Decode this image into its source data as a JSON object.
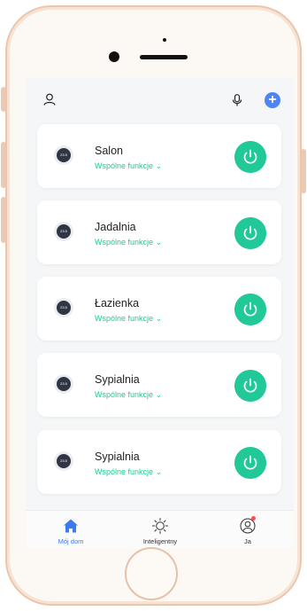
{
  "colors": {
    "accent": "#20c997",
    "primary_blue": "#4f84f5",
    "active_tab": "#3a7bf0",
    "badge": "#ff4d4f"
  },
  "header": {
    "left_icon": "user-icon",
    "right_icons": [
      "microphone-icon",
      "plus-icon"
    ]
  },
  "rooms": [
    {
      "name": "Salon",
      "subtitle": "Wspólne funkcje",
      "thermostat_reading": "23.5"
    },
    {
      "name": "Jadalnia",
      "subtitle": "Wspólne funkcje",
      "thermostat_reading": "23.5"
    },
    {
      "name": "Łazienka",
      "subtitle": "Wspólne funkcje",
      "thermostat_reading": "23.5"
    },
    {
      "name": "Sypialnia",
      "subtitle": "Wspólne funkcje",
      "thermostat_reading": "23.5"
    },
    {
      "name": "Sypialnia",
      "subtitle": "Wspólne funkcje",
      "thermostat_reading": "23.5"
    }
  ],
  "tabs": [
    {
      "label": "Mój dom",
      "icon": "home-icon",
      "active": true
    },
    {
      "label": "Inteligentny",
      "icon": "sun-icon",
      "active": false
    },
    {
      "label": "Ja",
      "icon": "profile-icon",
      "active": false
    }
  ]
}
